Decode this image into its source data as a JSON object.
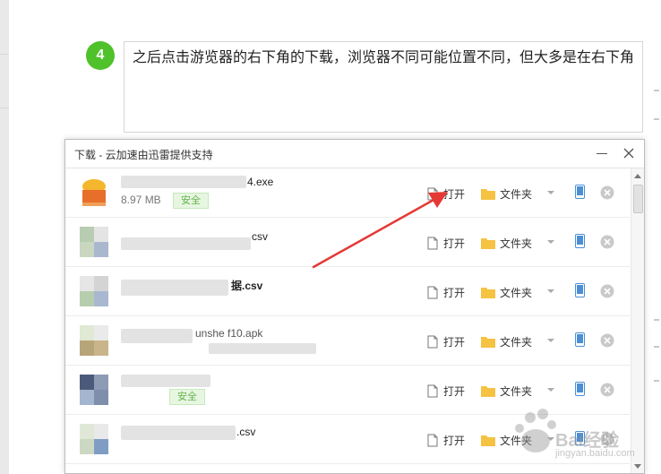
{
  "article": {
    "step_number": "4",
    "step_text": "之后点击游览器的右下角的下载，浏览器不同可能位置不同，但大多是在右下角"
  },
  "download_window": {
    "title": "下载 - 云加速由迅雷提供支持",
    "open_label": "打开",
    "folder_label": "文件夹",
    "items": [
      {
        "name": "4.exe",
        "size": "8.97 MB",
        "badge": "安全"
      },
      {
        "name": "csv"
      },
      {
        "name": "据.csv"
      },
      {
        "name": "unshe        f10.apk"
      },
      {
        "badge": "安全"
      },
      {
        "name": ".csv"
      }
    ]
  },
  "watermark": {
    "text": "Bai经验",
    "url": "jingyan.baidu.com"
  },
  "colors": {
    "accent_green": "#4fc12a",
    "safe_green": "#62b34a",
    "arrow_red": "#e53935",
    "folder_yellow": "#f5c242",
    "phone_blue": "#4a8fd6"
  }
}
